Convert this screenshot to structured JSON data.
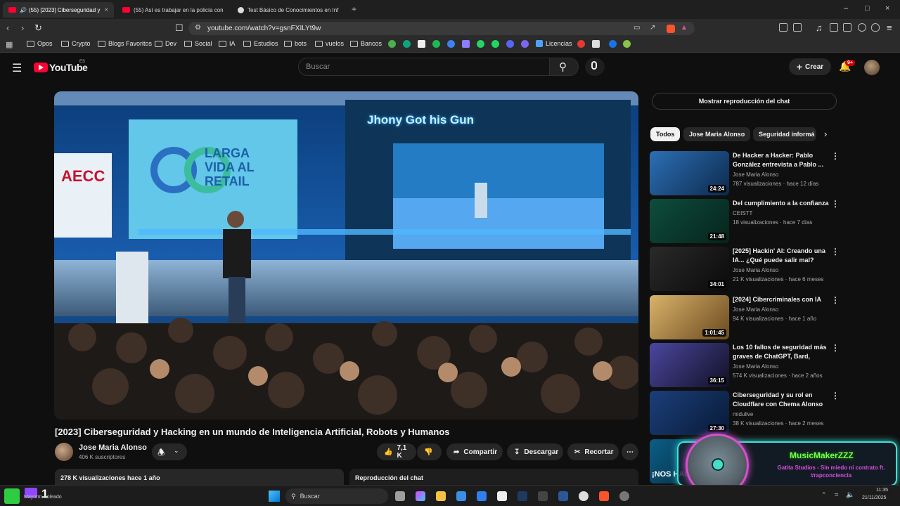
{
  "browser": {
    "tabs": [
      {
        "label": "(55) [2023] Ciberseguridad y",
        "active": true
      },
      {
        "label": "(55) Así es trabajar en la policía con",
        "active": false
      },
      {
        "label": "Test Básico de Conocimientos en Inf",
        "active": false
      }
    ],
    "url": "youtube.com/watch?v=gsnFXILYt9w",
    "bookmarks": [
      "Opos",
      "Crypto",
      "Blogs Favoritos",
      "Dev",
      "Social",
      "IA",
      "Estudios",
      "bots",
      "vuelos",
      "Bancos",
      "Licencias"
    ]
  },
  "youtube": {
    "logo_text": "YouTube",
    "region": "ES",
    "search_placeholder": "Buscar",
    "create_label": "Crear",
    "notif_count": "9+"
  },
  "video": {
    "slide_title": "Jhony Got his Gun",
    "banner_left": "AECC",
    "banner_right": "LARGA VIDA AL RETAIL",
    "title": "[2023] Ciberseguridad y Hacking en un mundo de Inteligencia Artificial, Robots y Humanos",
    "channel": "Jose Maria Alonso",
    "subscribers": "406 K suscriptores",
    "likes": "7,1 K",
    "share_label": "Compartir",
    "download_label": "Descargar",
    "clip_label": "Recortar",
    "views_age": "278 K visualizaciones  hace 1 año",
    "chat_replay": "Reproducción del chat"
  },
  "sidebar": {
    "show_chat": "Mostrar reproducción del chat",
    "chips": [
      "Todos",
      "Jose Maria Alonso",
      "Seguridad informá"
    ],
    "recommendations": [
      {
        "title": "De Hacker a Hacker: Pablo González entrevista a Pablo ...",
        "channel": "Jose Maria Alonso",
        "meta": "787 visualizaciones · hace 12 días",
        "duration": "24:24",
        "color": "#2c6fb5"
      },
      {
        "title": "Del cumplimiento a la confianza",
        "channel": "CEISTT",
        "meta": "18 visualizaciones · hace 7 días",
        "duration": "21:48",
        "color": "#0d4d3c"
      },
      {
        "title": "[2025] Hackin' AI: Creando una IA... ¿Qué puede salir mal? por...",
        "channel": "Jose Maria Alonso",
        "meta": "21 K visualizaciones · hace 6 meses",
        "duration": "34:01",
        "color": "#1a1a1a"
      },
      {
        "title": "[2024] Cibercriminales con IA",
        "channel": "Jose Maria Alonso",
        "meta": "94 K visualizaciones · hace 1 año",
        "duration": "1:01:45",
        "color": "#b88a3a"
      },
      {
        "title": "Los 10 fallos de seguridad más graves de ChatGPT, Bard, Llam...",
        "channel": "Jose Maria Alonso",
        "meta": "574 K visualizaciones · hace 2 años",
        "duration": "36:15",
        "color": "#3d3a6b"
      },
      {
        "title": "Ciberseguridad y su rol en Cloudflare con Chema Alonso ...",
        "channel": "midulive",
        "meta": "38 K visualizaciones · hace 2 meses",
        "duration": "27:30",
        "color": "#1b3f7a"
      }
    ],
    "partial_thumb_text": "¡NOS HACK"
  },
  "overlay": {
    "name": "MusicMakerZZZ",
    "message": "Gatita Studios - Sin miedo ni contrato ft. #rapconciencia"
  },
  "taskbar": {
    "weather": "Mayorm. soleado",
    "search": "Buscar",
    "time": "11:35",
    "date": "21/11/2025"
  }
}
